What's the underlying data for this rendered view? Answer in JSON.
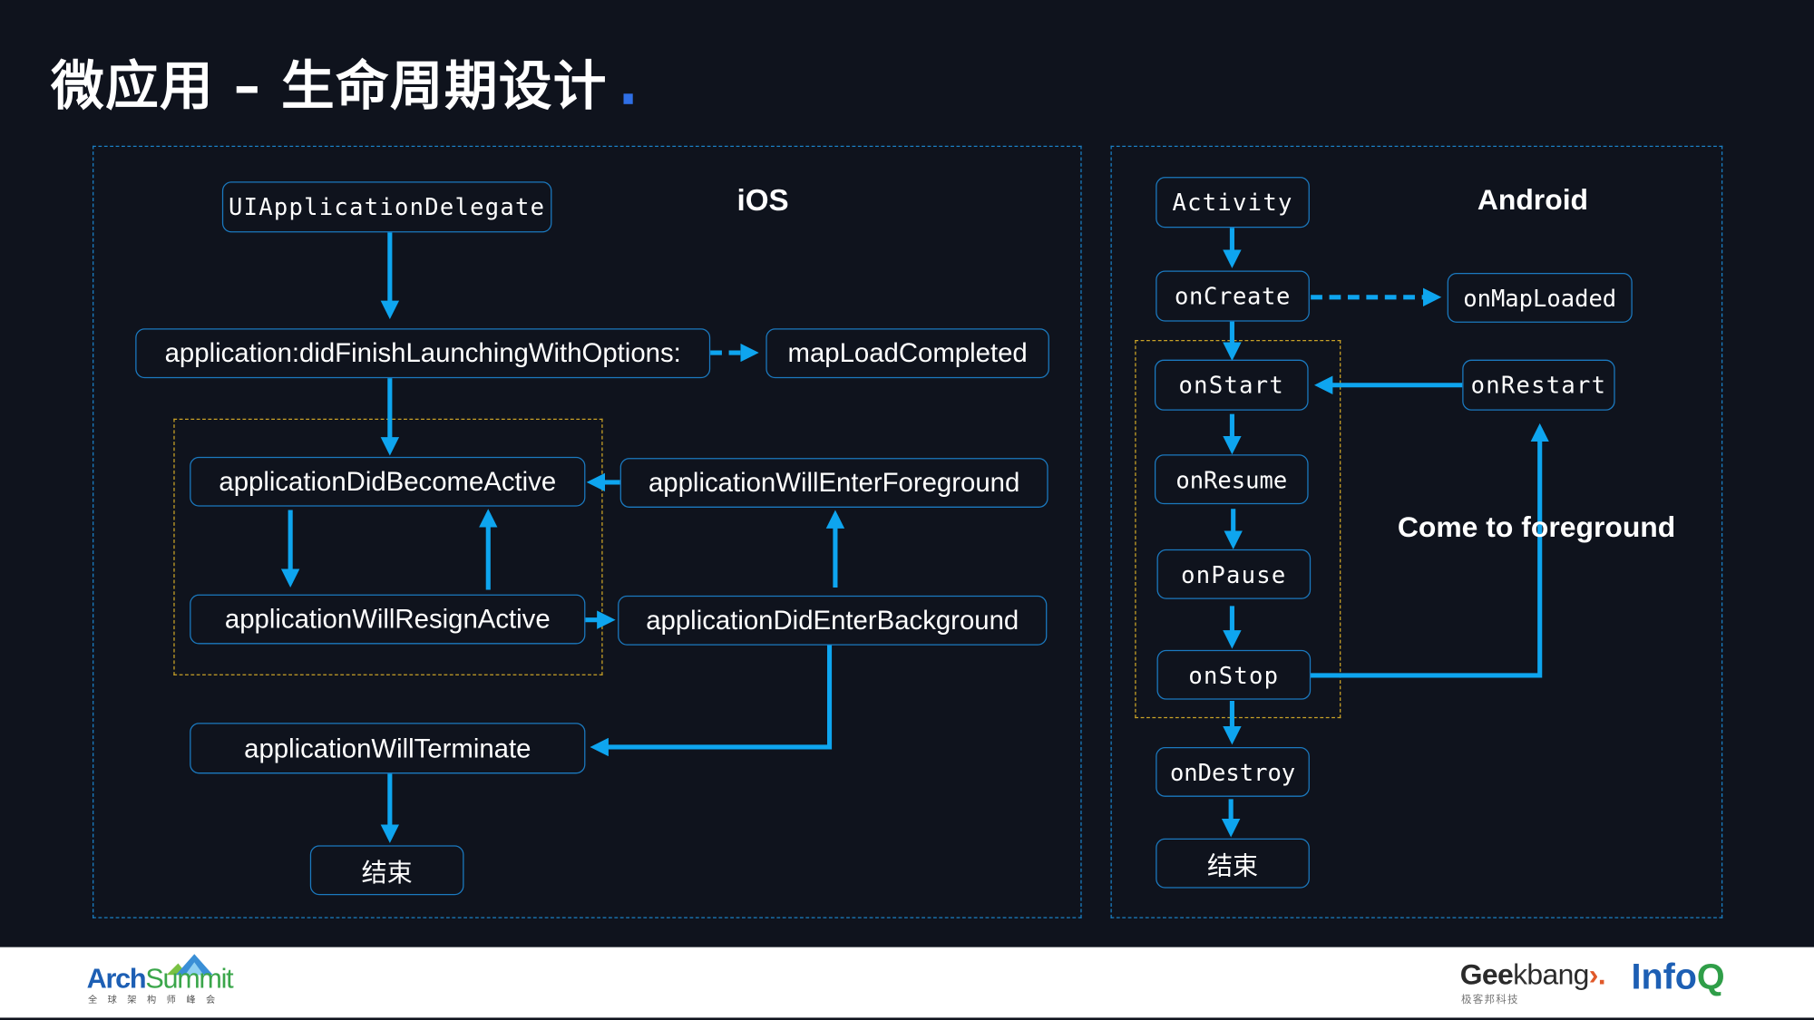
{
  "slide": {
    "title": "微应用 – 生命周期设计",
    "accent_color": "#2f6fe6"
  },
  "ios": {
    "heading": "iOS",
    "nodes": {
      "delegate": "UIApplicationDelegate",
      "did_finish": "application:didFinishLaunchingWithOptions:",
      "map_load_completed": "mapLoadCompleted",
      "did_become_active": "applicationDidBecomeActive",
      "will_enter_foreground": "applicationWillEnterForeground",
      "will_resign_active": "applicationWillResignActive",
      "did_enter_background": "applicationDidEnterBackground",
      "will_terminate": "applicationWillTerminate",
      "end": "结束"
    }
  },
  "android": {
    "heading": "Android",
    "annotation": "Come to foreground",
    "nodes": {
      "activity": "Activity",
      "on_create": "onCreate",
      "on_map_loaded": "onMapLoaded",
      "on_start": "onStart",
      "on_restart": "onRestart",
      "on_resume": "onResume",
      "on_pause": "onPause",
      "on_stop": "onStop",
      "on_destroy": "onDestroy",
      "end": "结束"
    }
  },
  "colors": {
    "background": "#0f131d",
    "arrow": "#0ea5ef",
    "node_border": "#1b79bf",
    "group_border": "#c9a227"
  },
  "footer": {
    "left_logo": {
      "brand_a": "Arch",
      "brand_b": "Summit",
      "subtitle": "全球架构师峰会"
    },
    "right_logo_1": {
      "brand_a": "Gee",
      "brand_k": "k",
      "brand_b": "bang",
      "mark": "›.",
      "subtitle": "极客邦科技"
    },
    "right_logo_2": {
      "brand_a": "Info",
      "brand_b": "Q"
    }
  }
}
